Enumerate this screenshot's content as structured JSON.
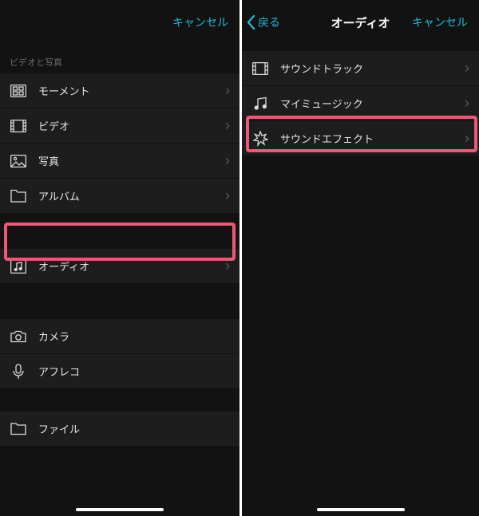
{
  "left": {
    "nav": {
      "cancel": "キャンセル"
    },
    "section_header": "ビデオと写真",
    "rows1": [
      {
        "label": "モーメント"
      },
      {
        "label": "ビデオ"
      },
      {
        "label": "写真"
      },
      {
        "label": "アルバム"
      }
    ],
    "rows2": [
      {
        "label": "オーディオ"
      }
    ],
    "rows3": [
      {
        "label": "カメラ"
      },
      {
        "label": "アフレコ"
      }
    ],
    "rows4": [
      {
        "label": "ファイル"
      }
    ]
  },
  "right": {
    "nav": {
      "back": "戻る",
      "title": "オーディオ",
      "cancel": "キャンセル"
    },
    "rows": [
      {
        "label": "サウンドトラック"
      },
      {
        "label": "マイミュージック"
      },
      {
        "label": "サウンドエフェクト"
      }
    ]
  },
  "chevron": "›"
}
